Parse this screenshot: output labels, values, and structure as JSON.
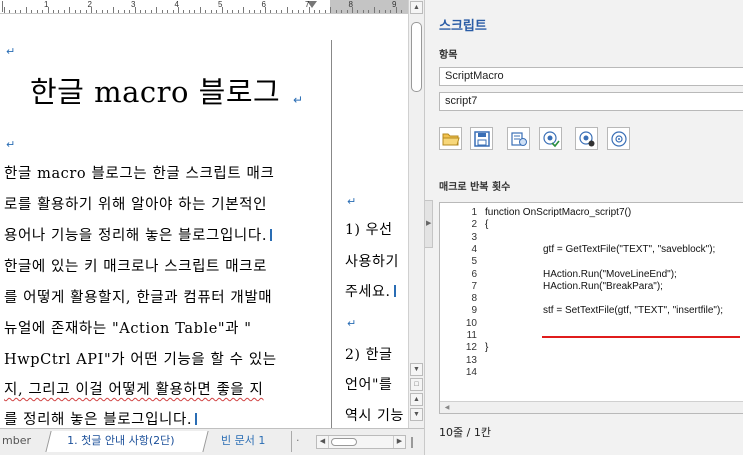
{
  "editor": {
    "ruler_numbers": [
      "1",
      "2",
      "3",
      "4",
      "5",
      "6",
      "7",
      "8",
      "9"
    ],
    "title": "한글 macro 블로그",
    "body_lines": [
      "한글 macro 블로그는 한글 스크립트 매크",
      "로를 활용하기 위해 알아야 하는 기본적인",
      "용어나 기능을 정리해 놓은 블로그입니다.",
      "한글에 있는 키 매크로나 스크립트 매크로",
      "를 어떻게 활용할지, 한글과 컴퓨터 개발매",
      "뉴얼에 존재하는 \"Action Table\"과 \"",
      "HwpCtrl API\"가 어떤 기능을 할 수 있는",
      "지, 그리고 이걸 어떻게 활용하면 좋을 지",
      "를 정리해 놓은 블로그입니다."
    ],
    "right_column_lines": [
      "1) 우선",
      "사용하기",
      "주세요.",
      "2) 한글",
      "언어\"를",
      "역시 기능"
    ],
    "paragraph_mark": "↵"
  },
  "tabs": {
    "left_partial": "mber",
    "active": "1. 첫글 안내 사항(2단)",
    "blank": "빈 문서 1",
    "more": "·"
  },
  "panel": {
    "title": "스크립트",
    "items_label": "항목",
    "macro_field": "ScriptMacro",
    "script_field": "script7",
    "toolbar": [
      {
        "name": "open-folder-icon"
      },
      {
        "name": "save-icon"
      },
      {
        "name": "script-edit-icon"
      },
      {
        "name": "script-check-icon"
      },
      {
        "name": "script-record-icon"
      },
      {
        "name": "script-run-icon"
      }
    ],
    "repeat_label": "매크로 반복 횟수",
    "code_lines": [
      {
        "num": "1",
        "text": "function OnScriptMacro_script7()",
        "indent": 0
      },
      {
        "num": "2",
        "text": "{",
        "indent": 0
      },
      {
        "num": "3",
        "text": "",
        "indent": 0
      },
      {
        "num": "4",
        "text": "gtf = GetTextFile(\"TEXT\", \"saveblock\");",
        "indent": 1
      },
      {
        "num": "5",
        "text": "",
        "indent": 0
      },
      {
        "num": "6",
        "text": "HAction.Run(\"MoveLineEnd\");",
        "indent": 1
      },
      {
        "num": "7",
        "text": "HAction.Run(\"BreakPara\");",
        "indent": 1
      },
      {
        "num": "8",
        "text": "",
        "indent": 0
      },
      {
        "num": "9",
        "text": "stf = SetTextFile(gtf, \"TEXT\", \"insertfile\");",
        "indent": 1
      },
      {
        "num": "10",
        "text": "",
        "indent": 0
      },
      {
        "num": "11",
        "text": "",
        "indent": 0
      },
      {
        "num": "12",
        "text": "}",
        "indent": 0
      },
      {
        "num": "13",
        "text": "",
        "indent": 0
      },
      {
        "num": "14",
        "text": "",
        "indent": 0
      }
    ],
    "status": "10줄 / 1칸"
  },
  "colors": {
    "accent_blue": "#2a5ca6",
    "paragraph_mark_blue": "#2a6db4",
    "highlight_red": "#e01c1c"
  }
}
